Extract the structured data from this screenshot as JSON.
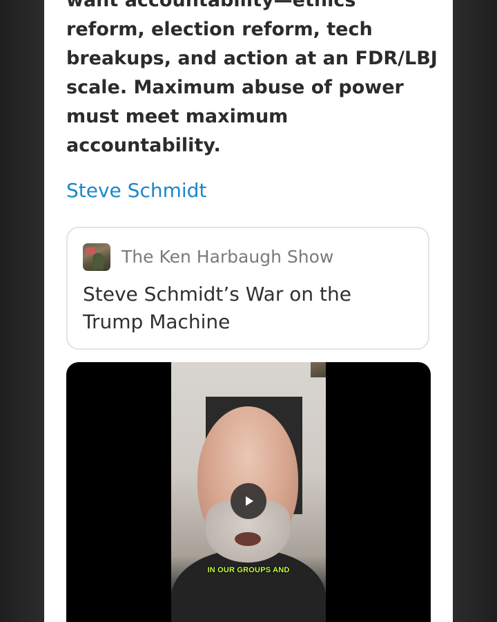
{
  "article": {
    "quote_text": "want accountability—ethics\nreform, election reform, tech\nbreakups, and action at an FDR/LBJ\nscale. Maximum abuse of power\nmust meet maximum\naccountability.",
    "attribution": "Steve Schmidt"
  },
  "embed_card": {
    "publication_name": "The Ken Harbaugh Show",
    "post_title": "Steve Schmidt’s War on the Trump Machine"
  },
  "video": {
    "caption": "IN OUR GROUPS AND",
    "play_icon": "play-icon"
  }
}
